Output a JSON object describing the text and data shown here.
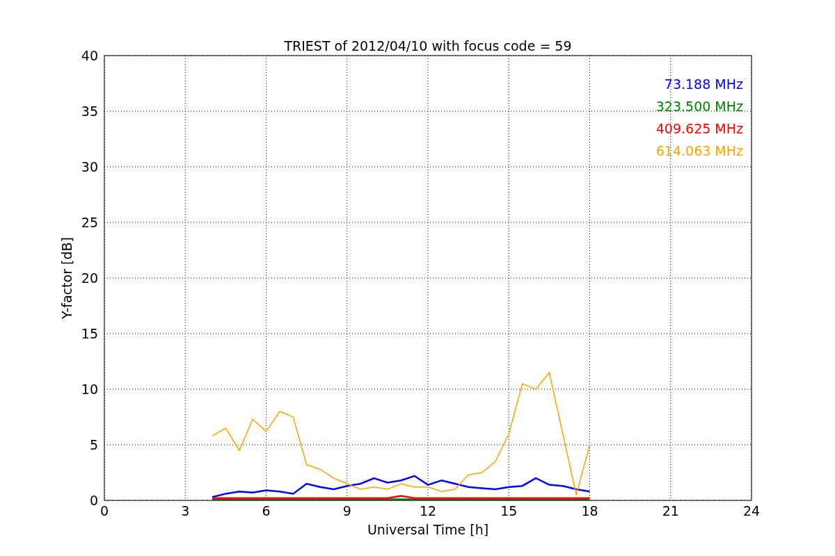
{
  "chart_data": {
    "type": "line",
    "title": "TRIEST of 2012/04/10 with focus code = 59",
    "xlabel": "Universal Time [h]",
    "ylabel": "Y-factor [dB]",
    "x": [
      4,
      4.5,
      5,
      5.5,
      6,
      6.5,
      7,
      7.5,
      8,
      8.5,
      9,
      9.5,
      10,
      10.5,
      11,
      11.5,
      12,
      12.5,
      13,
      13.5,
      14,
      14.5,
      15,
      15.5,
      16,
      16.5,
      17,
      17.5,
      18
    ],
    "series": [
      {
        "name": "73.188 MHz",
        "color": "#0000ff",
        "values": [
          0.3,
          0.6,
          0.8,
          0.7,
          0.9,
          0.8,
          0.6,
          1.5,
          1.2,
          1.0,
          1.3,
          1.5,
          2.0,
          1.6,
          1.8,
          2.2,
          1.4,
          1.8,
          1.5,
          1.2,
          1.1,
          1.0,
          1.2,
          1.3,
          2.0,
          1.4,
          1.3,
          1.0,
          0.8
        ]
      },
      {
        "name": "323.500 MHz",
        "color": "#008000",
        "values": [
          0.1,
          0.1,
          0.1,
          0.1,
          0.1,
          0.1,
          0.1,
          0.1,
          0.1,
          0.1,
          0.1,
          0.1,
          0.1,
          0.1,
          0.1,
          0.1,
          0.1,
          0.1,
          0.1,
          0.1,
          0.1,
          0.1,
          0.1,
          0.1,
          0.1,
          0.1,
          0.1,
          0.1,
          0.1
        ]
      },
      {
        "name": "409.625 MHz",
        "color": "#ff0000",
        "values": [
          0.2,
          0.2,
          0.2,
          0.2,
          0.2,
          0.2,
          0.2,
          0.2,
          0.2,
          0.2,
          0.2,
          0.2,
          0.2,
          0.2,
          0.4,
          0.2,
          0.2,
          0.2,
          0.2,
          0.2,
          0.2,
          0.2,
          0.2,
          0.2,
          0.2,
          0.2,
          0.2,
          0.2,
          0.2
        ]
      },
      {
        "name": "614.063 MHz",
        "color": "#ffa500",
        "values": [
          5.8,
          6.5,
          4.5,
          7.3,
          6.2,
          8.0,
          7.5,
          3.2,
          2.8,
          2.0,
          1.5,
          1.0,
          1.2,
          1.0,
          1.5,
          1.2,
          1.2,
          0.8,
          1.0,
          2.3,
          2.5,
          3.5,
          6.0,
          10.5,
          10.0,
          11.5,
          6.0,
          0.5,
          5.0
        ]
      }
    ],
    "xlim": [
      0,
      24
    ],
    "ylim": [
      0,
      40
    ],
    "xticks": [
      0,
      3,
      6,
      9,
      12,
      15,
      18,
      21,
      24
    ],
    "yticks": [
      0,
      5,
      10,
      15,
      20,
      25,
      30,
      35,
      40
    ],
    "grid": true
  }
}
